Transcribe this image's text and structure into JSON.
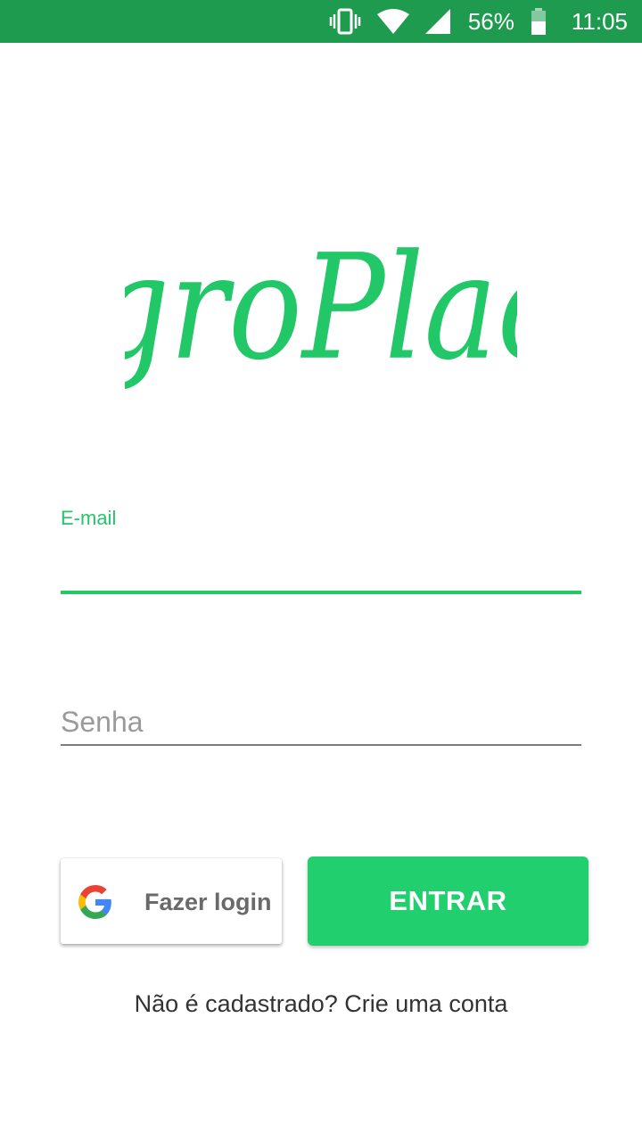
{
  "status_bar": {
    "battery_percent": "56%",
    "time": "11:05",
    "icons": [
      "vibrate-icon",
      "wifi-icon",
      "signal-icon",
      "battery-icon"
    ],
    "background_color": "#1e9b4f"
  },
  "logo": {
    "text": "AgroPlace",
    "color": "#22c768"
  },
  "login_form": {
    "email_label": "E-mail",
    "email_value": "",
    "password_placeholder": "Senha",
    "password_value": "",
    "accent_color": "#22c768"
  },
  "buttons": {
    "google_label": "Fazer login",
    "google_icon": "google-icon",
    "enter_label": "ENTRAR",
    "enter_color": "#22cf6e"
  },
  "footer": {
    "signup_text": "Não é cadastrado? Crie uma conta"
  }
}
